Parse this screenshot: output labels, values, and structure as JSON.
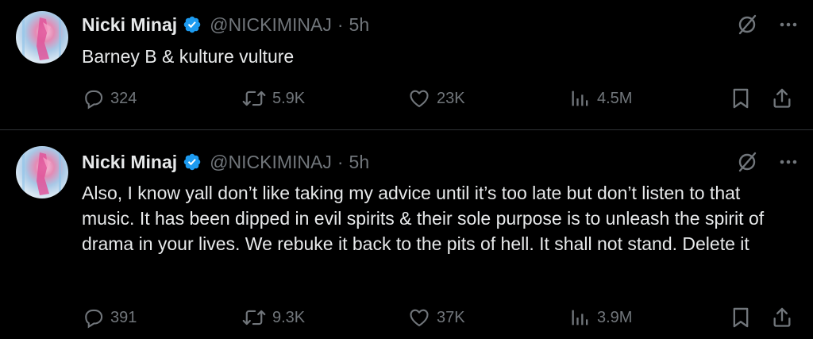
{
  "tweets": [
    {
      "author_name": "Nicki Minaj",
      "handle": "@NICKIMINAJ",
      "separator": "·",
      "time": "5h",
      "text": "Barney B &  kulture vulture",
      "replies": "324",
      "reposts": "5.9K",
      "likes": "23K",
      "views": "4.5M"
    },
    {
      "author_name": "Nicki Minaj",
      "handle": "@NICKIMINAJ",
      "separator": "·",
      "time": "5h",
      "text": "Also, I know yall don’t like taking my advice until it’s too late but don’t listen to that music. It has been dipped in evil spirits & their sole purpose is to unleash the spirit of drama in your lives. We rebuke it back to the pits of hell. It shall not stand. Delete it",
      "replies": "391",
      "reposts": "9.3K",
      "likes": "37K",
      "views": "3.9M"
    }
  ],
  "colors": {
    "background": "#000000",
    "primary_text": "#e7e9ea",
    "secondary_text": "#71767b",
    "verified_badge": "#1d9bf0",
    "divider": "#2f3336"
  },
  "icons": [
    "verified-badge-icon",
    "grok-icon",
    "more-icon",
    "reply-icon",
    "repost-icon",
    "like-icon",
    "views-icon",
    "bookmark-icon",
    "share-icon"
  ]
}
